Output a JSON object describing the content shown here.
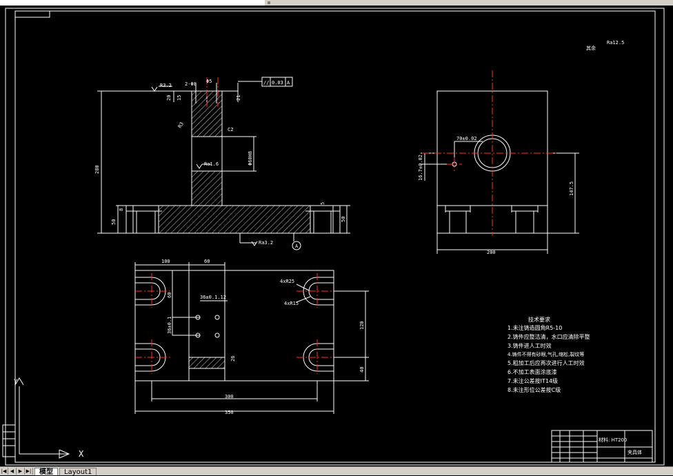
{
  "drawing": {
    "front_view": {
      "dims": [
        "2-Φ8",
        "Φ5",
        "R3.2",
        "20",
        "15",
        "21",
        "C2",
        "R3",
        "Φ60H8",
        "Ra1.6",
        "280",
        "8",
        "50",
        "50",
        "5",
        "Ra3.2",
        "A"
      ],
      "tolerance_frame": [
        "//",
        "0.03",
        "A"
      ]
    },
    "side_view": {
      "dims": [
        "70±0.02",
        "16.7±0.02",
        "147.5",
        "200"
      ]
    },
    "top_view": {
      "dims": [
        "100",
        "60",
        "36±0.1.12",
        "4xR25",
        "4xR15",
        "36±0.1",
        "60",
        "120",
        "40",
        "26",
        "300",
        "350"
      ]
    },
    "surface_finish_note": [
      "其余",
      "Ra12.5"
    ],
    "tech_requirements": {
      "title": "技术要求",
      "items": [
        "1.未注铸造圆角R5-10",
        "2.铸件应整洁清，水口应清除平整",
        "3.铸件进人工时效",
        "4.铸件不得有砂眼,气孔,缩松,裂纹等",
        "5.粗加工后应再次进行人工时效",
        "6.不加工表面涂底漆",
        "7.未注公差按IT14级",
        "8.未注形位公差按C级"
      ]
    },
    "title_block": {
      "material": "材料: HT200",
      "part_name": "夹具体"
    }
  },
  "ucs": {
    "y_label": "Y",
    "x_label": "X"
  },
  "tabs": {
    "nav": [
      "|◀",
      "◀",
      "▶",
      "▶|"
    ],
    "items": [
      "模型",
      "Layout1"
    ]
  },
  "colors": {
    "background": "#000000",
    "lines": "#ffffff",
    "centerlines": "#ff0000",
    "ui": "#d4d0c8"
  }
}
